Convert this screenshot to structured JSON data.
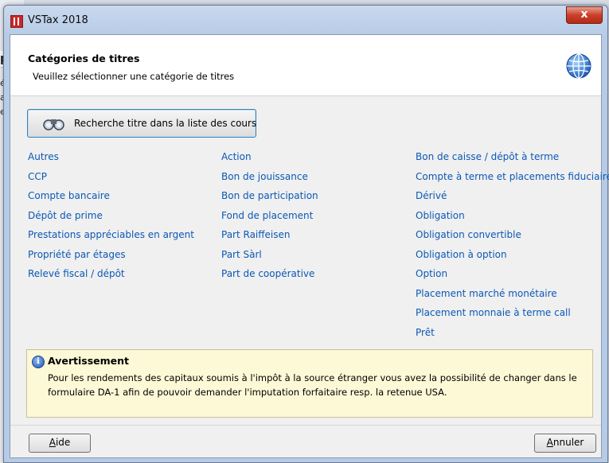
{
  "window": {
    "title": "VSTax 2018",
    "close_glyph": "x"
  },
  "header": {
    "title": "Catégories de titres",
    "subtitle": "Veuillez sélectionner une catégorie de titres",
    "icon": "globe-icon"
  },
  "search_button": {
    "label": "Recherche titre dans la liste des cours",
    "icon": "binoculars-icon"
  },
  "categories": {
    "col1": [
      "Autres",
      "CCP",
      "Compte bancaire",
      "Dépôt de prime",
      "Prestations appréciables en argent",
      "Propriété par étages",
      "Relevé fiscal / dépôt"
    ],
    "col2": [
      "Action",
      "Bon de jouissance",
      "Bon de participation",
      "Fond de placement",
      "Part Raiffeisen",
      "Part Sàrl",
      "Part de coopérative"
    ],
    "col3": [
      "Bon de caisse / dépôt à terme",
      "Compte à terme et placements fiduciaires",
      "Dérivé",
      "Obligation",
      "Obligation convertible",
      "Obligation à option",
      "Option",
      "Placement marché monétaire",
      "Placement monnaie à terme call",
      "Prêt"
    ]
  },
  "warning": {
    "title": "Avertissement",
    "text": "Pour les rendements des capitaux soumis à l'impôt à la source étranger vous avez la possibilité de changer dans le formulaire DA-1 afin de pouvoir demander l'imputation forfaitaire resp. la retenue USA.",
    "icon": "info-icon"
  },
  "footer": {
    "aide_first": "A",
    "aide_rest": "ide",
    "annuler_first": "A",
    "annuler_rest": "nnuler"
  },
  "background": {
    "fragments": [
      "p",
      "ée",
      "at",
      "er"
    ]
  },
  "colors": {
    "link": "#0b58b5",
    "warning_bg": "#fdf8d6",
    "close": "#c8402a"
  }
}
